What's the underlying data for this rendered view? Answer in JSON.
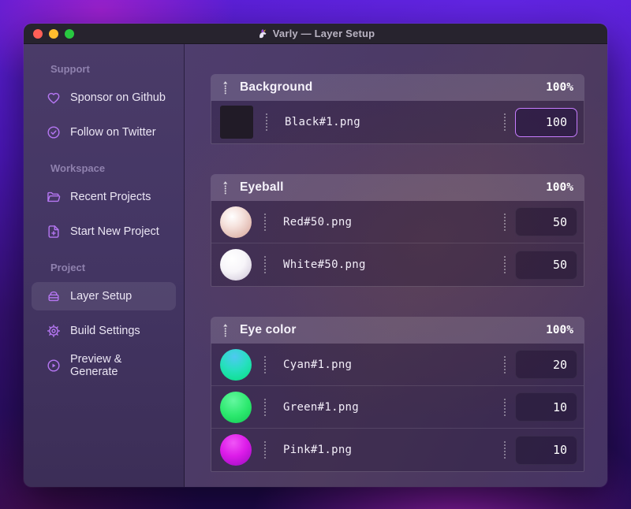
{
  "window": {
    "title": "Varly — Layer Setup",
    "app_icon": "unicorn-icon"
  },
  "sidebar": {
    "sections": [
      {
        "label": "Support",
        "items": [
          {
            "icon": "heart-icon",
            "label": "Sponsor on Github"
          },
          {
            "icon": "badge-check-icon",
            "label": "Follow on Twitter"
          }
        ]
      },
      {
        "label": "Workspace",
        "items": [
          {
            "icon": "folder-open-icon",
            "label": "Recent Projects"
          },
          {
            "icon": "document-plus-icon",
            "label": "Start New Project"
          }
        ]
      },
      {
        "label": "Project",
        "items": [
          {
            "icon": "layers-icon",
            "label": "Layer Setup",
            "selected": true
          },
          {
            "icon": "gear-icon",
            "label": "Build Settings"
          },
          {
            "icon": "play-circle-icon",
            "label": "Preview & Generate"
          }
        ]
      }
    ]
  },
  "content": {
    "groups": [
      {
        "name": "Background",
        "weight": "100%",
        "rows": [
          {
            "thumb": "black-square",
            "file": "Black#1.png",
            "value": "100",
            "focused": true
          }
        ]
      },
      {
        "name": "Eyeball",
        "weight": "100%",
        "rows": [
          {
            "thumb": "pearl-sphere",
            "file": "Red#50.png",
            "value": "50"
          },
          {
            "thumb": "white-sphere",
            "file": "White#50.png",
            "value": "50"
          }
        ]
      },
      {
        "name": "Eye color",
        "weight": "100%",
        "rows": [
          {
            "thumb": "cyan-sphere",
            "file": "Cyan#1.png",
            "value": "20"
          },
          {
            "thumb": "green-sphere",
            "file": "Green#1.png",
            "value": "10"
          },
          {
            "thumb": "pink-sphere",
            "file": "Pink#1.png",
            "value": "10"
          }
        ]
      }
    ]
  },
  "colors": {
    "accent": "#c77dff",
    "sidebar_icon": "#b576f2",
    "traffic_red": "#ff5f57",
    "traffic_yellow": "#febc2e",
    "traffic_green": "#28c840",
    "thumb_black": "#211b27",
    "thumb_pearl": "#e9cdc6",
    "thumb_white": "#f4f2f6",
    "thumb_cyan": "#18e3b2",
    "thumb_green": "#23e168",
    "thumb_pink": "#d41ae3"
  }
}
